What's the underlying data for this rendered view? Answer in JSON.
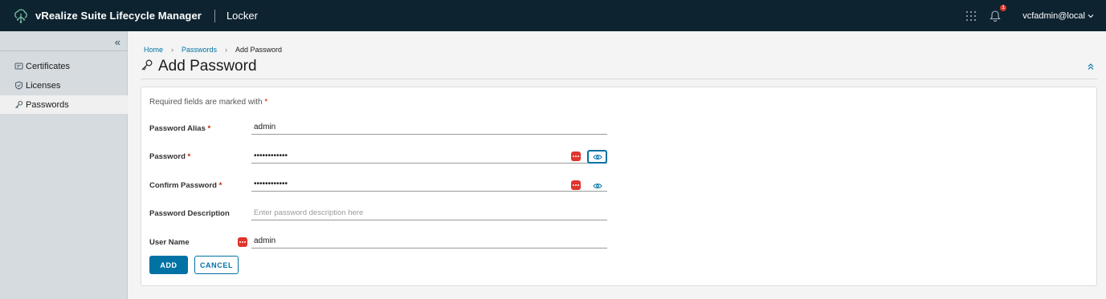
{
  "header": {
    "app_title": "vRealize Suite Lifecycle Manager",
    "section": "Locker",
    "notification_count": "1",
    "user": "vcfadmin@local",
    "logo_icon": "vrealize-cloud-logo",
    "apps_icon": "app-grid-icon",
    "bell_icon": "bell-icon"
  },
  "sidebar": {
    "collapse_icon": "double-chevron-left",
    "items": [
      {
        "label": "Certificates",
        "icon": "certificate-icon",
        "active": false
      },
      {
        "label": "Licenses",
        "icon": "license-shield-icon",
        "active": false
      },
      {
        "label": "Passwords",
        "icon": "key-icon",
        "active": true
      }
    ]
  },
  "breadcrumb": {
    "home": "Home",
    "passwords": "Passwords",
    "current": "Add Password"
  },
  "page": {
    "title": "Add Password",
    "title_icon": "key-icon"
  },
  "form": {
    "required_note": "Required fields are marked with",
    "required_star": "*",
    "alias": {
      "label": "Password Alias",
      "required": "*",
      "value": "admin"
    },
    "password": {
      "label": "Password",
      "required": "*",
      "value": "••••••••••••"
    },
    "confirm": {
      "label": "Confirm Password",
      "required": "*",
      "value": "••••••••••••"
    },
    "description": {
      "label": "Password Description",
      "placeholder": "Enter password description here"
    },
    "username": {
      "label": "User Name",
      "value": "admin"
    },
    "add_button": "ADD",
    "cancel_button": "CANCEL"
  },
  "colors": {
    "header_bg": "#0e2330",
    "sidebar_bg": "#d6dbdf",
    "accent": "#0072a3",
    "badge_red": "#e0342c"
  }
}
